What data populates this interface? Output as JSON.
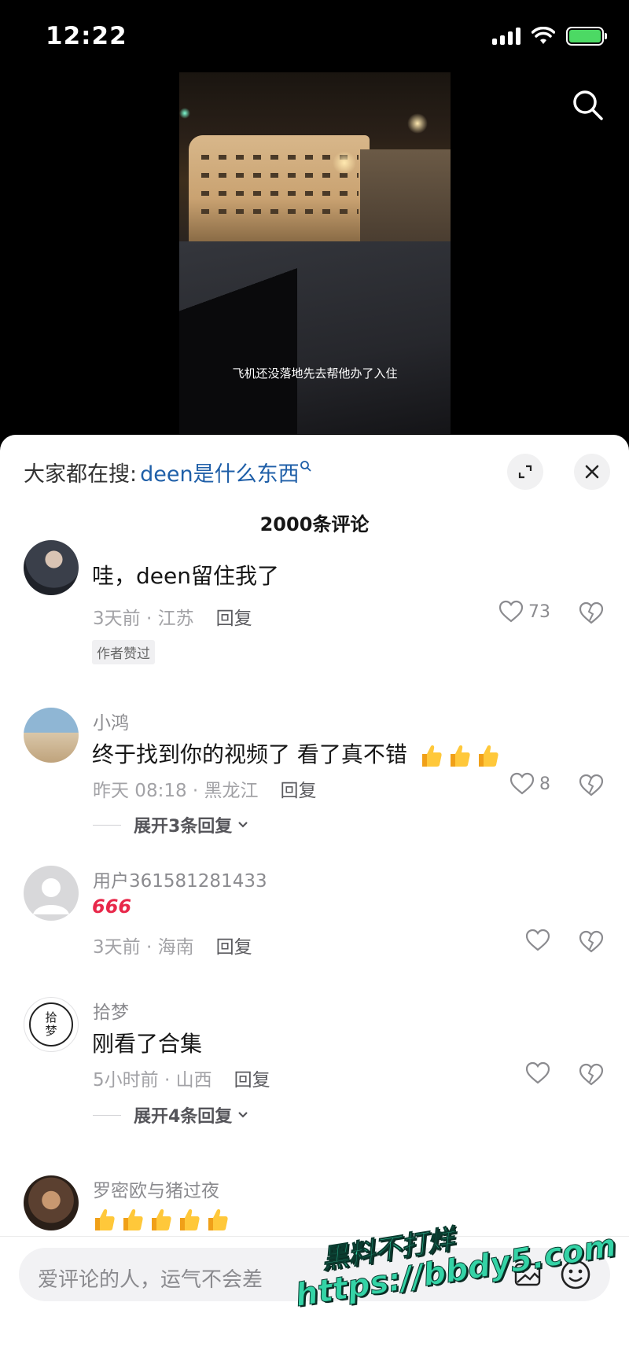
{
  "status_bar": {
    "time": "12:22"
  },
  "video": {
    "subtitle": "飞机还没落地先去帮他办了入住"
  },
  "sheet": {
    "hot_search_prefix": "大家都在搜:",
    "hot_search_query": "deen是什么东西",
    "comment_count": "2000条评论"
  },
  "comments": [
    {
      "name": "",
      "text": "哇，deen留住我了",
      "time_location": "3天前 · 江苏",
      "reply_label": "回复",
      "likes": "73",
      "badge": "作者赞过"
    },
    {
      "name": "小鸿",
      "text": "终于找到你的视频了 看了真不错",
      "time_location": "昨天 08:18 · 黑龙江",
      "reply_label": "回复",
      "likes": "8",
      "expand": "展开3条回复"
    },
    {
      "name": "用户361581281433",
      "text": "666",
      "time_location": "3天前 · 海南",
      "reply_label": "回复",
      "likes": ""
    },
    {
      "name": "拾梦",
      "avatar_text": "拾梦",
      "text": "刚看了合集",
      "time_location": "5小时前 · 山西",
      "reply_label": "回复",
      "likes": "",
      "expand": "展开4条回复"
    },
    {
      "name": "罗密欧与猪过夜",
      "text": "",
      "time_location": "",
      "reply_label": ""
    }
  ],
  "input": {
    "placeholder": "爱评论的人，运气不会差"
  },
  "watermark": {
    "line1": "黑料不打烊",
    "line2": "https://bbdy5.com"
  },
  "colors": {
    "link_blue": "#1f5fa8",
    "text": "#161616",
    "meta": "#a2a2a6",
    "battery": "#4cd964"
  },
  "icons": [
    "search-icon",
    "expand-icon",
    "close-icon",
    "heart-icon",
    "dislike-icon",
    "thumbs-up-icon",
    "chevron-down-icon",
    "image-icon",
    "emoji-icon"
  ]
}
